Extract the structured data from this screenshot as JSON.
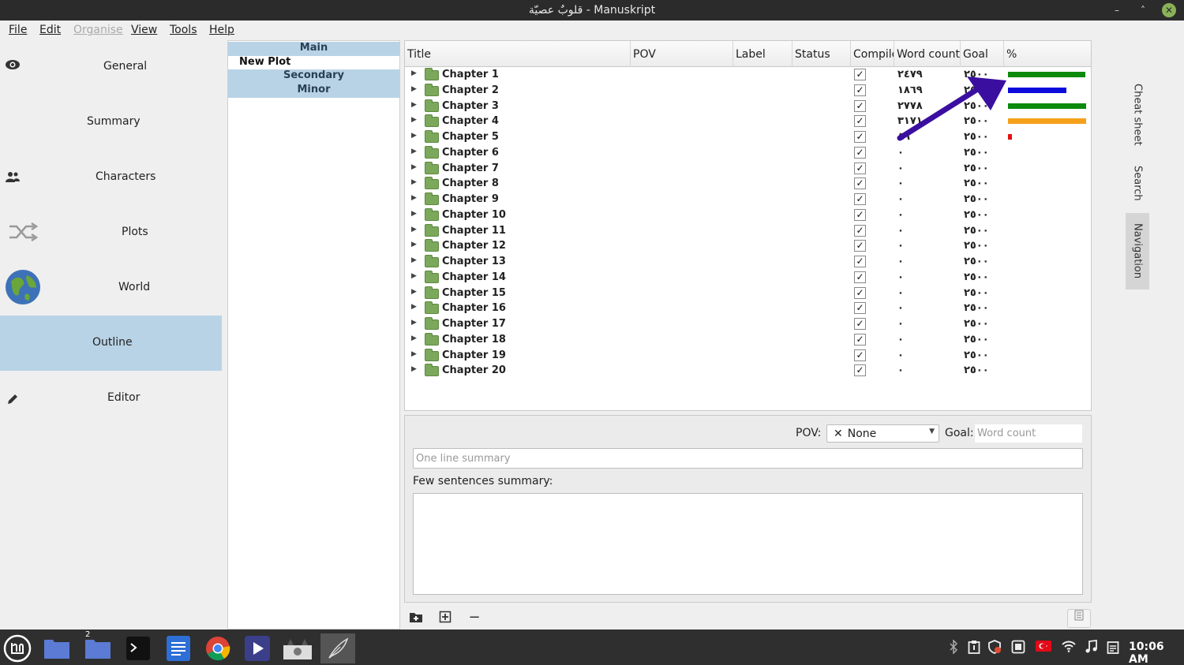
{
  "window": {
    "title": "قلوبٌ عصيّة - Manuskript",
    "minimize": "–",
    "maximize": "˄",
    "close": "✕"
  },
  "menu": [
    "File",
    "Edit",
    "Organise",
    "View",
    "Tools",
    "Help"
  ],
  "nav": {
    "items": [
      {
        "label": "General",
        "icon": "eye-icon"
      },
      {
        "label": "Summary",
        "icon": ""
      },
      {
        "label": "Characters",
        "icon": "people-icon"
      },
      {
        "label": "Plots",
        "icon": "shuffle-icon"
      },
      {
        "label": "World",
        "icon": "globe-icon"
      },
      {
        "label": "Outline",
        "icon": "",
        "active": true
      },
      {
        "label": "Editor",
        "icon": "pencil-icon"
      }
    ]
  },
  "plots": [
    {
      "label": "Main",
      "kind": "group"
    },
    {
      "label": "New Plot",
      "kind": "item"
    },
    {
      "label": "Secondary",
      "kind": "group"
    },
    {
      "label": "Minor",
      "kind": "group"
    }
  ],
  "outline": {
    "columns": [
      "Title",
      "POV",
      "Label",
      "Status",
      "Compile",
      "Word count",
      "Goal",
      "%"
    ],
    "rows": [
      {
        "title": "Chapter 1",
        "compile": true,
        "word_count": "٢٤٧٩",
        "goal": "٢٥٠٠",
        "progress": 0.99,
        "color": "#0b8a0b"
      },
      {
        "title": "Chapter 2",
        "compile": true,
        "word_count": "١٨٦٩",
        "goal": "٢٥٠٠",
        "progress": 0.75,
        "color": "#0b0bdc"
      },
      {
        "title": "Chapter 3",
        "compile": true,
        "word_count": "٢٧٧٨",
        "goal": "٢٥٠٠",
        "progress": 1.0,
        "color": "#0b8a0b"
      },
      {
        "title": "Chapter 4",
        "compile": true,
        "word_count": "٣١٧١",
        "goal": "٢٥٠٠",
        "progress": 1.0,
        "color": "#f5a01a"
      },
      {
        "title": "Chapter 5",
        "compile": true,
        "word_count": "٨٩",
        "goal": "٢٥٠٠",
        "progress": 0.04,
        "color": "#e81010"
      },
      {
        "title": "Chapter 6",
        "compile": true,
        "word_count": "٠",
        "goal": "٢٥٠٠"
      },
      {
        "title": "Chapter 7",
        "compile": true,
        "word_count": "٠",
        "goal": "٢٥٠٠"
      },
      {
        "title": "Chapter 8",
        "compile": true,
        "word_count": "٠",
        "goal": "٢٥٠٠"
      },
      {
        "title": "Chapter 9",
        "compile": true,
        "word_count": "٠",
        "goal": "٢٥٠٠"
      },
      {
        "title": "Chapter 10",
        "compile": true,
        "word_count": "٠",
        "goal": "٢٥٠٠"
      },
      {
        "title": "Chapter 11",
        "compile": true,
        "word_count": "٠",
        "goal": "٢٥٠٠"
      },
      {
        "title": "Chapter 12",
        "compile": true,
        "word_count": "٠",
        "goal": "٢٥٠٠"
      },
      {
        "title": "Chapter 13",
        "compile": true,
        "word_count": "٠",
        "goal": "٢٥٠٠"
      },
      {
        "title": "Chapter 14",
        "compile": true,
        "word_count": "٠",
        "goal": "٢٥٠٠"
      },
      {
        "title": "Chapter 15",
        "compile": true,
        "word_count": "٠",
        "goal": "٢٥٠٠"
      },
      {
        "title": "Chapter 16",
        "compile": true,
        "word_count": "٠",
        "goal": "٢٥٠٠"
      },
      {
        "title": "Chapter 17",
        "compile": true,
        "word_count": "٠",
        "goal": "٢٥٠٠"
      },
      {
        "title": "Chapter 18",
        "compile": true,
        "word_count": "٠",
        "goal": "٢٥٠٠"
      },
      {
        "title": "Chapter 19",
        "compile": true,
        "word_count": "٠",
        "goal": "٢٥٠٠"
      },
      {
        "title": "Chapter 20",
        "compile": true,
        "word_count": "٠",
        "goal": "٢٥٠٠"
      }
    ],
    "annotation_arrow_color": "#3a0fa0"
  },
  "details": {
    "pov_label": "POV:",
    "pov_value": "None",
    "pov_clear": "✕",
    "goal_label": "Goal:",
    "goal_placeholder": "Word count",
    "one_line_placeholder": "One line summary",
    "few_sentences_label": "Few sentences summary:"
  },
  "toolbar": {
    "add_folder": "+",
    "add_text": "⊞",
    "remove": "−"
  },
  "right_tabs": [
    "Cheat sheet",
    "Search",
    "Navigation"
  ],
  "taskbar": {
    "clock": "10:06 AM",
    "badge": "2"
  }
}
